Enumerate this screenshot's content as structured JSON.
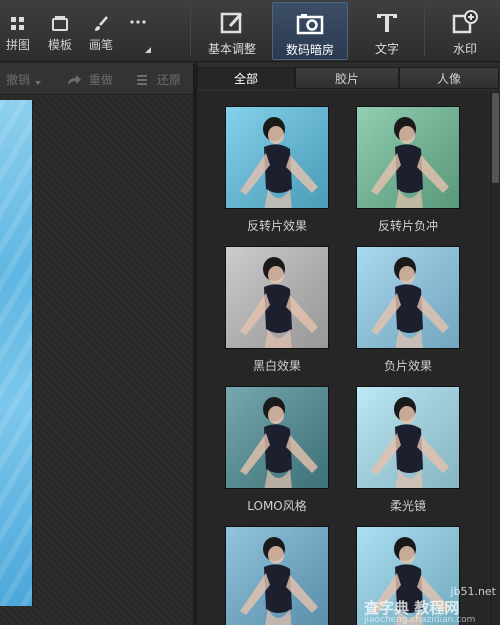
{
  "toolbar": {
    "small_tools": [
      {
        "label": "拼图",
        "icon": "grid-icon"
      },
      {
        "label": "模板",
        "icon": "template-icon"
      },
      {
        "label": "画笔",
        "icon": "brush-icon"
      }
    ],
    "more_icon": "more-dots-icon",
    "big_tools": [
      {
        "label": "基本调整",
        "icon": "adjust-edit-icon",
        "active": false
      },
      {
        "label": "数码暗房",
        "icon": "camera-icon",
        "active": true
      },
      {
        "label": "文字",
        "icon": "text-T-icon",
        "active": false
      },
      {
        "label": "水印",
        "icon": "watermark-plus-icon",
        "active": false
      }
    ]
  },
  "actions": {
    "undo": "撤销",
    "redo": "重做",
    "restore": "还原"
  },
  "panel": {
    "tabs": [
      "全部",
      "胶片",
      "人像"
    ],
    "active_tab": "全部",
    "effects": [
      {
        "label": "反转片效果",
        "tone": "#5ec3e6"
      },
      {
        "label": "反转片负冲",
        "tone": "#6fbf9a"
      },
      {
        "label": "黑白效果",
        "tone": "#bdbdbd"
      },
      {
        "label": "负片效果",
        "tone": "#8fcfee"
      },
      {
        "label": "LOMO风格",
        "tone": "#4c8d96"
      },
      {
        "label": "柔光镜",
        "tone": "#a9e2f3"
      },
      {
        "label": "",
        "tone": "#6fb2d3"
      },
      {
        "label": "",
        "tone": "#8fd6ee"
      }
    ]
  },
  "watermark": {
    "site": "jb51.net",
    "text": "查字典 教程网",
    "url": "jiaocheng.chazidian.com"
  },
  "colors": {
    "accent_active": "#3c4e66",
    "background": "#2b2b2b"
  }
}
